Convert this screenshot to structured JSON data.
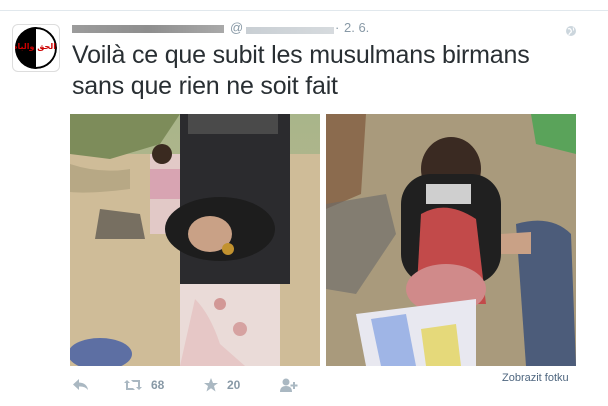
{
  "avatar": {
    "text": "الحق والباطل"
  },
  "header": {
    "at": "@",
    "separator": "·",
    "timestamp": "2. 6."
  },
  "tweet": {
    "text_line1": "Voilà ce que subit les musulmans birmans",
    "text_line2": "sans que rien ne soit fait"
  },
  "actions": {
    "reply_icon": "reply-icon",
    "retweet_icon": "retweet-icon",
    "retweet_count": "68",
    "favorite_icon": "star-icon",
    "favorite_count": "20",
    "follow_icon": "add-user-icon"
  },
  "media": {
    "view_photo_label": "Zobrazit fotku"
  },
  "colors": {
    "text": "#292f33",
    "muted": "#8899a6",
    "link": "#4e667f"
  }
}
